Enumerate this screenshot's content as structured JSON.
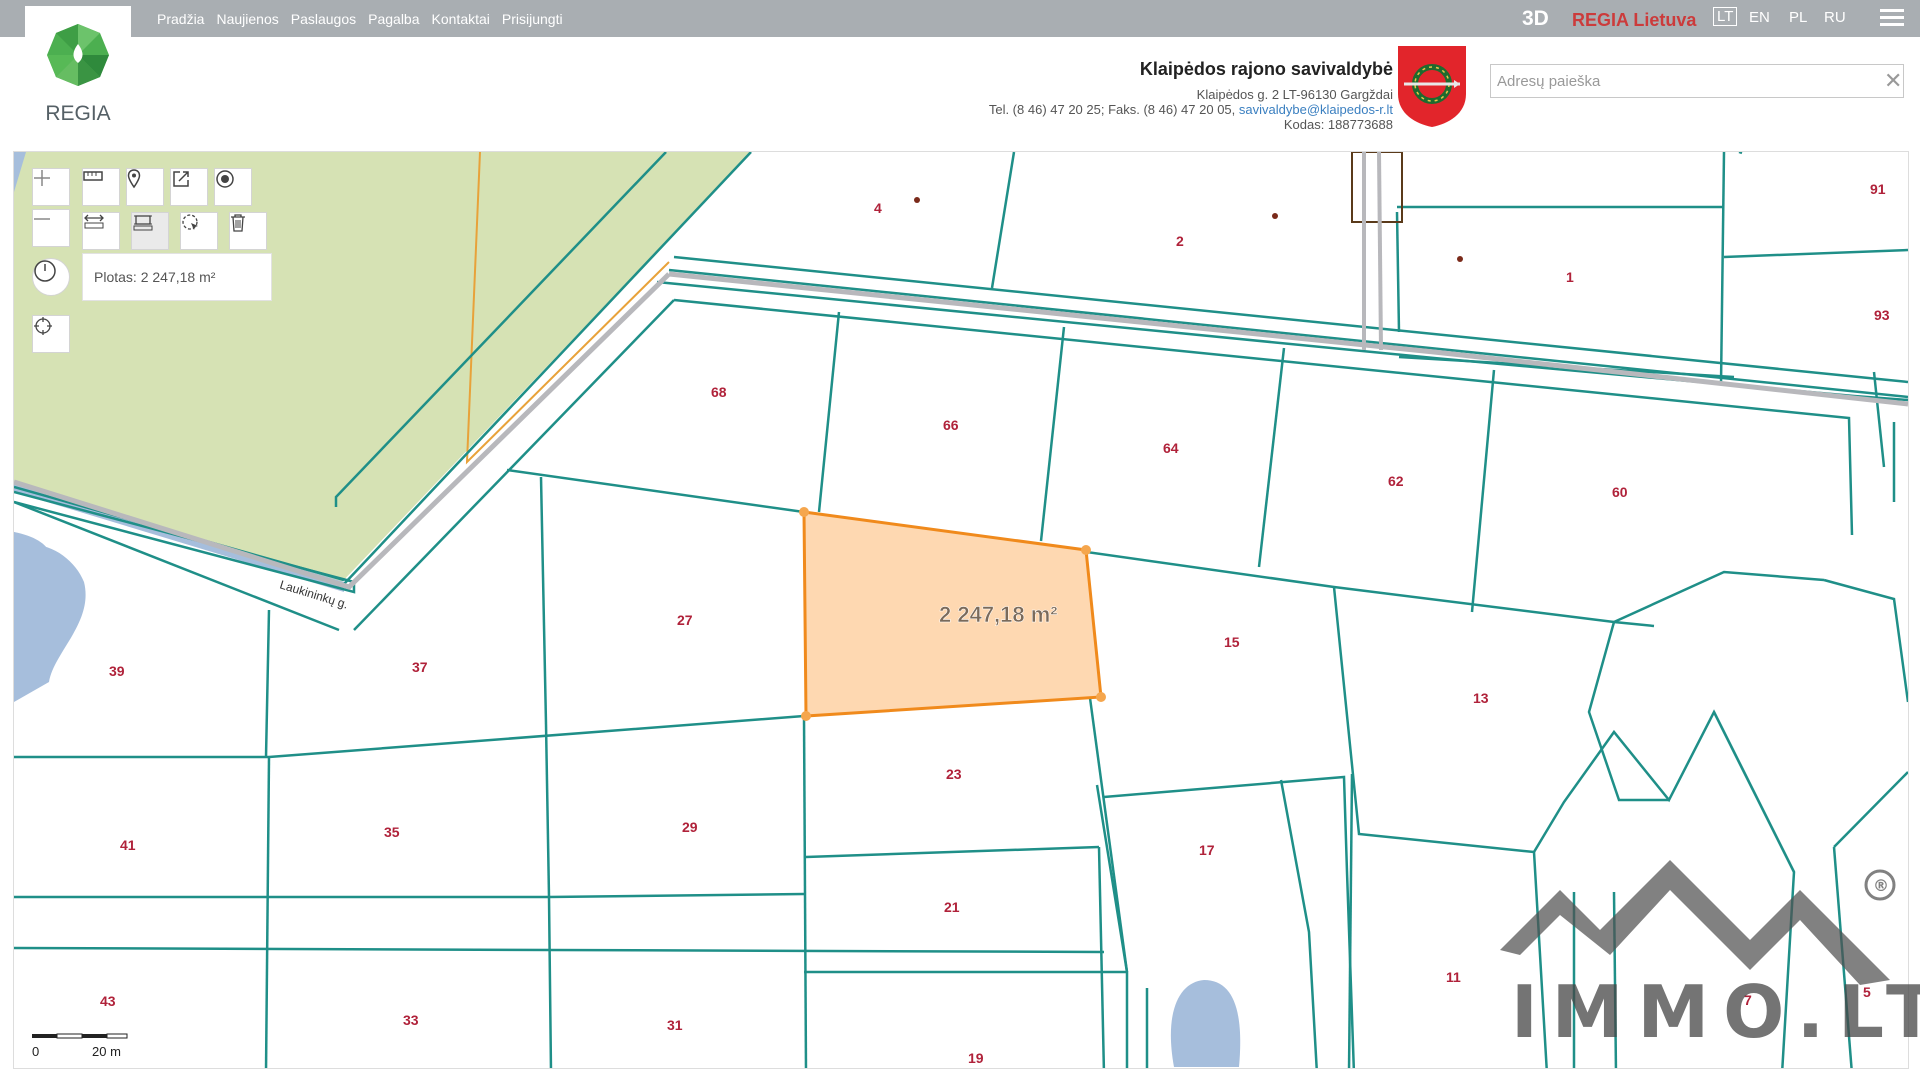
{
  "nav": {
    "items": [
      "Pradžia",
      "Naujienos",
      "Paslaugos",
      "Pagalba",
      "Kontaktai",
      "Prisijungti"
    ]
  },
  "header": {
    "mode_3d": "3D",
    "brand": "REGIA Lietuva",
    "languages": [
      "LT",
      "EN",
      "PL",
      "RU"
    ],
    "selected_language": "LT",
    "logo_text": "REGIA",
    "menu_icon": "hamburger-icon"
  },
  "municipality": {
    "name": "Klaipėdos rajono savivaldybė",
    "address": "Klaipėdos g. 2 LT-96130 Gargždai",
    "tel": "Tel. (8 46) 47 20 25; Faks. (8 46) 47 20 05, ",
    "email": "savivaldybe@klaipedos-r.lt",
    "code": "Kodas: 188773688",
    "coat_icon": "coat-of-arms-icon"
  },
  "search": {
    "placeholder": "Adresų paieška",
    "value": ""
  },
  "map": {
    "measure_label": "Plotas: 2 247,18 m²",
    "area_label": "2 247,18 m²",
    "street_label": "Laukininkų g.",
    "scale_zero": "0",
    "scale_label": "20 m",
    "lot_numbers": [
      "4",
      "2",
      "1",
      "91",
      "93",
      "68",
      "66",
      "64",
      "62",
      "60",
      "27",
      "15",
      "13",
      "39",
      "37",
      "41",
      "35",
      "29",
      "23",
      "17",
      "21",
      "11",
      "43",
      "33",
      "31",
      "19",
      "7",
      "5"
    ],
    "colors": {
      "parcel_line": "#1f8f88",
      "selected_fill": "#fed8b1",
      "selected_stroke": "#f08a1c",
      "forest": "#d6e2b4",
      "water": "#a6bedc",
      "road": "#b8b8bc",
      "lot_number": "#b0223a"
    }
  },
  "tools": {
    "zoom_in_icon": "plus-icon",
    "zoom_out_icon": "minus-icon",
    "ruler_icon": "ruler-icon",
    "pin_icon": "pin-icon",
    "share_icon": "share-icon",
    "target_icon": "target-icon",
    "distance_icon": "distance-icon",
    "area_icon": "area-icon",
    "select_icon": "select-icon",
    "delete_icon": "trash-icon",
    "clock_icon": "clock-icon",
    "locate_icon": "crosshair-icon"
  },
  "watermark": {
    "text": "IMMO.LT",
    "registered": "®"
  }
}
